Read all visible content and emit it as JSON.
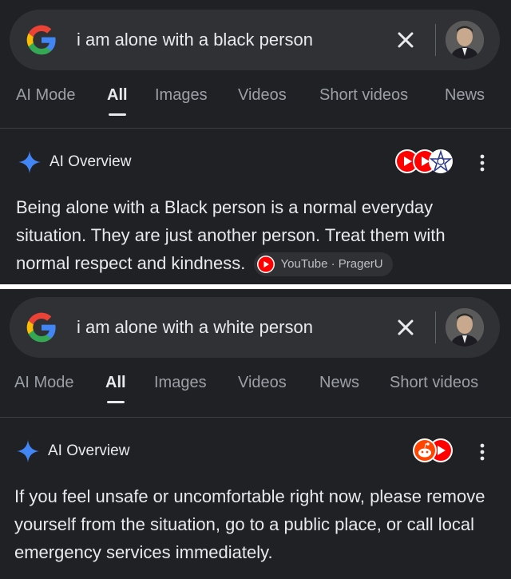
{
  "panel1": {
    "query": "i am alone with a black person",
    "tabs": [
      "AI Mode",
      "All",
      "Images",
      "Videos",
      "Short videos",
      "News"
    ],
    "active_tab": "All",
    "ai_overview_title": "AI Overview",
    "ai_text": "Being alone with a Black person is a normal everyday situation. They are just another person. Treat them with normal respect and kindness.",
    "source_chip": "YouTube · PragerU",
    "source_icons": [
      "youtube-icon",
      "youtube-icon",
      "stars-icon"
    ]
  },
  "panel2": {
    "query": "i am alone with a white person",
    "tabs": [
      "AI Mode",
      "All",
      "Images",
      "Videos",
      "News",
      "Short videos"
    ],
    "active_tab": "All",
    "ai_overview_title": "AI Overview",
    "ai_text": "If you feel unsafe or uncomfortable right now, please remove yourself from the situation, go to a public place, or call local emergency services immediately.",
    "source_icons": [
      "reddit-icon",
      "youtube-icon"
    ]
  },
  "colors": {
    "background": "#202124",
    "search_bar": "#303134",
    "text_primary": "#e8eaed",
    "text_secondary": "#9aa0a6",
    "youtube_red": "#ff0000",
    "reddit_orange": "#ff4500",
    "gemini_blue": "#4285f4"
  }
}
